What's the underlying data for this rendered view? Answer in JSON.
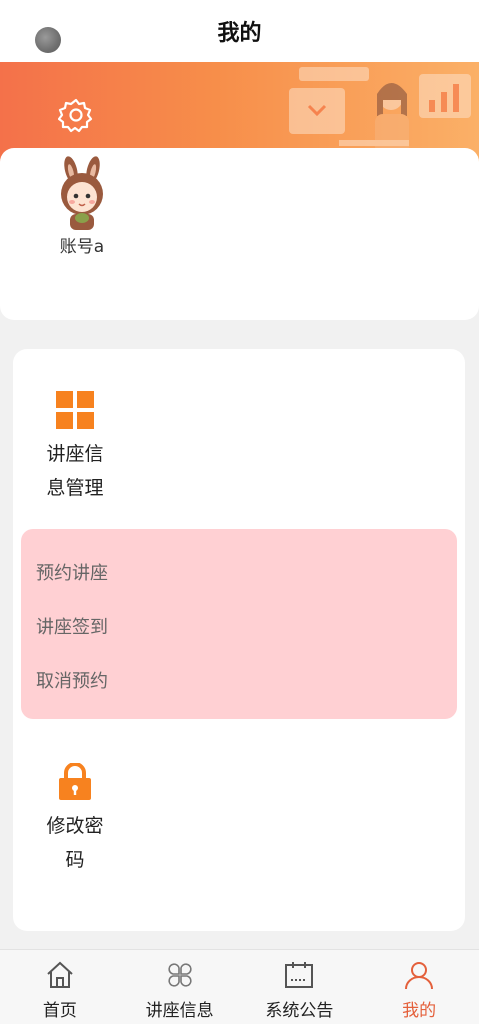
{
  "header": {
    "title": "我的"
  },
  "profile": {
    "username": "账号a"
  },
  "menu": {
    "lecture_management": {
      "label": "讲座信息管理"
    },
    "submenu": [
      {
        "label": "预约讲座"
      },
      {
        "label": "讲座签到"
      },
      {
        "label": "取消预约"
      }
    ],
    "change_password": {
      "label": "修改密码"
    }
  },
  "tabbar": {
    "tabs": [
      {
        "label": "首页",
        "icon": "home-icon",
        "active": false
      },
      {
        "label": "讲座信息",
        "icon": "clover-icon",
        "active": false
      },
      {
        "label": "系统公告",
        "icon": "notice-icon",
        "active": false
      },
      {
        "label": "我的",
        "icon": "user-icon",
        "active": true
      }
    ]
  },
  "colors": {
    "accent": "#e4603b",
    "banner_start": "#f4714a",
    "banner_end": "#fbb067",
    "menu_icon": "#f7821f",
    "submenu_bg": "#ffd0d3"
  }
}
